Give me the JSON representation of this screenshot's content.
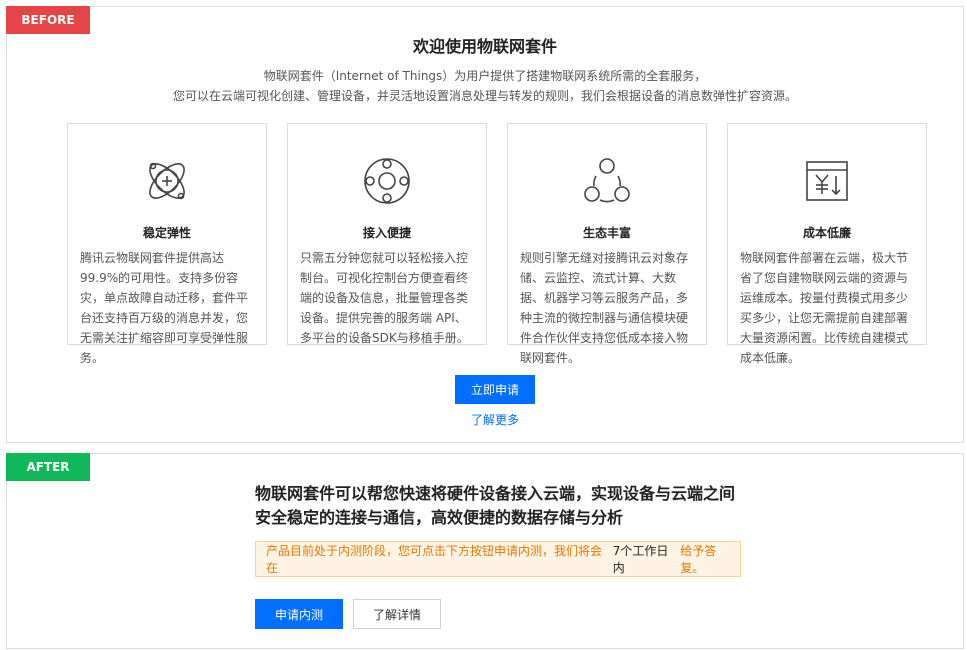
{
  "before": {
    "tag": "BEFORE",
    "title": "欢迎使用物联网套件",
    "desc_line1": "物联网套件（Internet of Things）为用户提供了搭建物联网系统所需的全套服务，",
    "desc_line2": "您可以在云端可视化创建、管理设备，并灵活地设置消息处理与转发的规则，我们会根据设备的消息数弹性扩容资源。",
    "cards": [
      {
        "icon": "atom-icon",
        "title": "稳定弹性",
        "text": "腾讯云物联网套件提供高达99.9%的可用性。支持多份容灾，单点故障自动迁移，套件平台还支持百万级的消息并发，您无需关注扩缩容即可享受弹性服务。"
      },
      {
        "icon": "connect-ring-icon",
        "title": "接入便捷",
        "text": "只需五分钟您就可以轻松接入控制台。可视化控制台方便查看终端的设备及信息，批量管理各类设备。提供完善的服务端 API、多平台的设备SDK与移植手册。"
      },
      {
        "icon": "ecosystem-icon",
        "title": "生态丰富",
        "text": "规则引擎无缝对接腾讯云对象存储、云监控、流式计算、大数据、机器学习等云服务产品，多种主流的微控制器与通信模块硬件合作伙伴支持您低成本接入物联网套件。"
      },
      {
        "icon": "cost-down-icon",
        "title": "成本低廉",
        "text": "物联网套件部署在云端，极大节省了您自建物联网云端的资源与运维成本。按量付费模式用多少买多少，让您无需提前自建部署大量资源闲置。比传统自建模式成本低廉。"
      }
    ],
    "apply_button": "立即申请",
    "learn_more_link": "了解更多"
  },
  "after": {
    "tag": "AFTER",
    "headline1": "物联网套件可以帮您快速将硬件设备接入云端，实现设备与云端之间",
    "headline2": "安全稳定的连接与通信，高效便捷的数据存储与分析",
    "notice_prefix": "产品目前处于内测阶段，您可点击下方按钮申请内测，我们将会在",
    "notice_highlight": "7个工作日内",
    "notice_suffix": "给予答复。",
    "beta_button": "申请内测",
    "detail_button": "了解详情"
  },
  "colors": {
    "before_tag": "#e54545",
    "after_tag": "#10b958",
    "primary": "#006eff",
    "notice_bg": "#fff4e3",
    "notice_text": "#e37900"
  }
}
